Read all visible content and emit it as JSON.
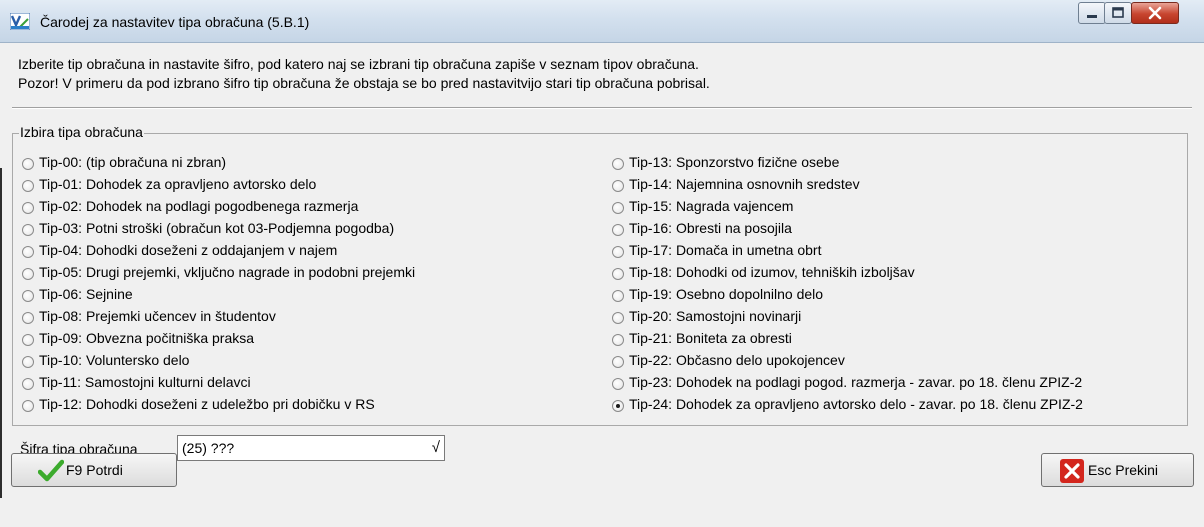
{
  "window": {
    "title": "Čarodej za nastavitev tipa obračuna  (5.B.1)",
    "close_color": "#c7452f"
  },
  "info": {
    "line1": "Izberite tip obračuna in nastavite šifro, pod katero naj se izbrani tip obračuna zapiše v seznam tipov obračuna.",
    "line2": "Pozor! V primeru da pod izbrano šifro tip obračuna že obstaja se bo pred nastavitvijo stari tip obračuna pobrisal."
  },
  "group": {
    "title": "Izbira tipa obračuna",
    "left": [
      {
        "label": "Tip-00: (tip obračuna ni zbran)",
        "checked": false
      },
      {
        "label": "Tip-01: Dohodek za opravljeno avtorsko delo",
        "checked": false
      },
      {
        "label": "Tip-02: Dohodek na podlagi pogodbenega razmerja",
        "checked": false
      },
      {
        "label": "Tip-03: Potni stroški (obračun kot 03-Podjemna pogodba)",
        "checked": false
      },
      {
        "label": "Tip-04: Dohodki doseženi z oddajanjem v najem",
        "checked": false
      },
      {
        "label": "Tip-05: Drugi prejemki, vključno nagrade in podobni prejemki",
        "checked": false
      },
      {
        "label": "Tip-06: Sejnine",
        "checked": false
      },
      {
        "label": "Tip-08: Prejemki učencev in študentov",
        "checked": false
      },
      {
        "label": "Tip-09: Obvezna počitniška praksa",
        "checked": false
      },
      {
        "label": "Tip-10: Voluntersko delo",
        "checked": false
      },
      {
        "label": "Tip-11: Samostojni kulturni delavci",
        "checked": false
      },
      {
        "label": "Tip-12: Dohodki doseženi z udeležbo pri dobičku v RS",
        "checked": false
      }
    ],
    "right": [
      {
        "label": "Tip-13: Sponzorstvo fizične osebe",
        "checked": false
      },
      {
        "label": "Tip-14: Najemnina osnovnih sredstev",
        "checked": false
      },
      {
        "label": "Tip-15: Nagrada vajencem",
        "checked": false
      },
      {
        "label": "Tip-16: Obresti na posojila",
        "checked": false
      },
      {
        "label": "Tip-17: Domača in umetna obrt",
        "checked": false
      },
      {
        "label": "Tip-18: Dohodki od izumov, tehniških izboljšav",
        "checked": false
      },
      {
        "label": "Tip-19: Osebno dopolnilno delo",
        "checked": false
      },
      {
        "label": "Tip-20: Samostojni novinarji",
        "checked": false
      },
      {
        "label": "Tip-21: Boniteta za obresti",
        "checked": false
      },
      {
        "label": "Tip-22: Občasno delo upokojencev",
        "checked": false
      },
      {
        "label": "Tip-23: Dohodek na podlagi pogod. razmerja - zavar. po 18. členu ZPIZ-2",
        "checked": false
      },
      {
        "label": "Tip-24: Dohodek za opravljeno avtorsko delo  - zavar. po 18. členu ZPIZ-2",
        "checked": true
      }
    ]
  },
  "code": {
    "label": "Šifra tipa obračuna",
    "value": "(25) ???",
    "check_glyph": "√"
  },
  "buttons": {
    "ok_label": "F9 Potrdi",
    "cancel_label": "Esc Prekini",
    "ok_color": "#3cab2d",
    "cancel_color": "#d3261d"
  }
}
